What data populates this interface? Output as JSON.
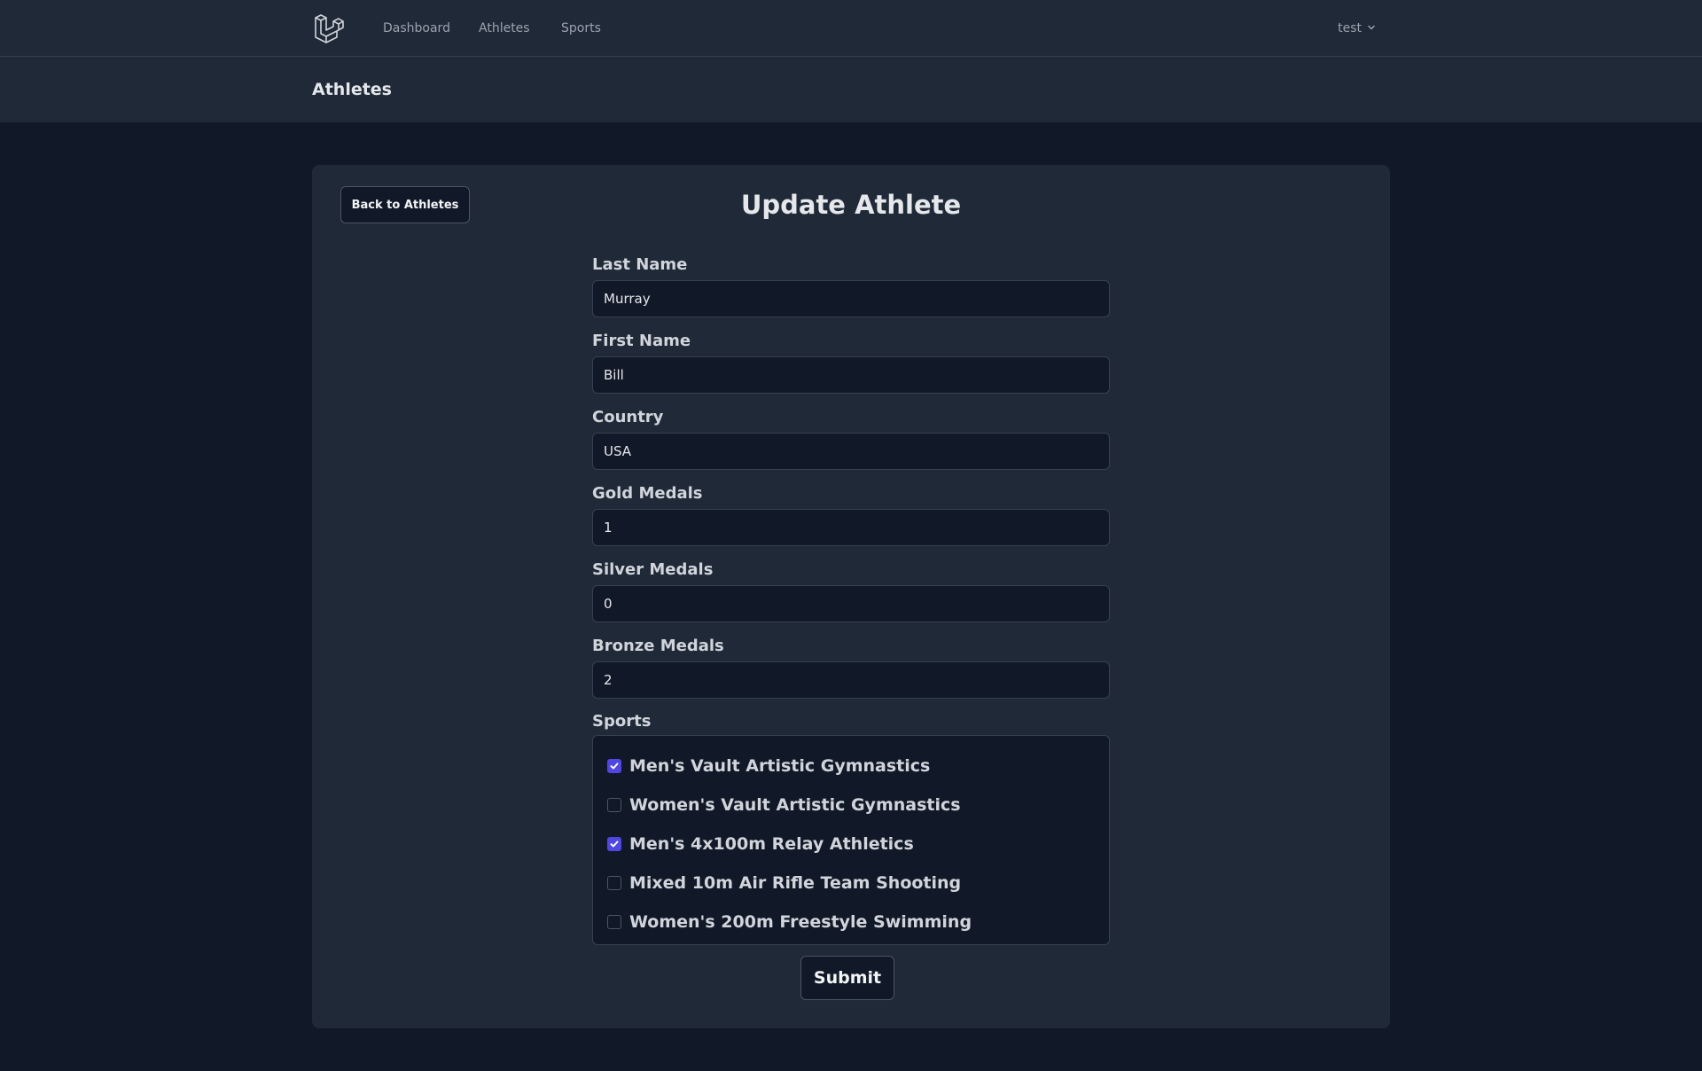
{
  "nav": {
    "logo_icon": "laravel-logo-icon",
    "links": [
      "Dashboard",
      "Athletes",
      "Sports"
    ],
    "user_name": "test",
    "user_menu_icon": "chevron-down-icon"
  },
  "page_header": {
    "title": "Athletes"
  },
  "form": {
    "back_label": "Back to Athletes",
    "title": "Update Athlete",
    "fields": [
      {
        "label": "Last Name",
        "value": "Murray"
      },
      {
        "label": "First Name",
        "value": "Bill"
      },
      {
        "label": "Country",
        "value": "USA"
      },
      {
        "label": "Gold Medals",
        "value": "1"
      },
      {
        "label": "Silver Medals",
        "value": "0"
      },
      {
        "label": "Bronze Medals",
        "value": "2"
      }
    ],
    "sports_label": "Sports",
    "sports": [
      {
        "label": "Men's Vault Artistic Gymnastics",
        "checked": true
      },
      {
        "label": "Women's Vault Artistic Gymnastics",
        "checked": false
      },
      {
        "label": "Men's 4x100m Relay Athletics",
        "checked": true
      },
      {
        "label": "Mixed 10m Air Rifle Team Shooting",
        "checked": false
      },
      {
        "label": "Women's 200m Freestyle Swimming",
        "checked": false
      }
    ],
    "submit_label": "Submit"
  },
  "colors": {
    "nav_bg": "#1f2937",
    "page_bg": "#111827",
    "checkbox_accent": "#4f46e5"
  }
}
